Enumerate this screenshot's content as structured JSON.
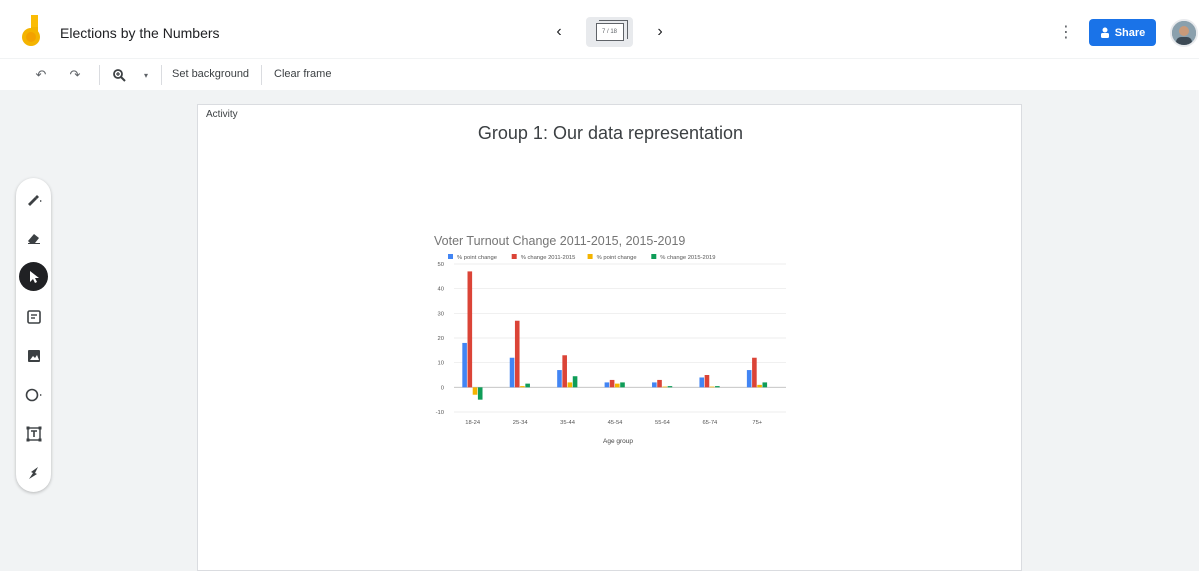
{
  "app": {
    "title": "Elections by the Numbers",
    "frame_counter": "7 / 18"
  },
  "header": {
    "share_label": "Share"
  },
  "toolbar": {
    "set_background": "Set background",
    "clear_frame": "Clear frame"
  },
  "canvas": {
    "activity_label": "Activity",
    "slide_title": "Group 1: Our data representation"
  },
  "colors": {
    "accent": "#1a73e8",
    "series_blue": "#4285f4",
    "series_red": "#db4437",
    "series_yellow": "#f4b400",
    "series_green": "#0f9d58"
  },
  "icons": [
    "undo-icon",
    "redo-icon",
    "zoom-icon",
    "pen-icon",
    "eraser-icon",
    "pointer-icon",
    "sticky-note-icon",
    "image-icon",
    "circle-icon",
    "text-box-icon",
    "laser-icon"
  ],
  "chart_data": {
    "type": "bar",
    "title": "Voter Turnout Change 2011-2015, 2015-2019",
    "xlabel": "Age group",
    "ylabel": "",
    "ylim": [
      -10,
      50
    ],
    "yticks": [
      -10,
      0,
      10,
      20,
      30,
      40,
      50
    ],
    "grid": true,
    "legend_position": "top",
    "categories": [
      "18-24",
      "25-34",
      "35-44",
      "45-54",
      "55-64",
      "65-74",
      "75+"
    ],
    "series": [
      {
        "name": "% point change",
        "color": "#4285f4",
        "values": [
          18,
          12,
          7,
          2,
          2,
          4,
          7
        ]
      },
      {
        "name": "% change 2011-2015",
        "color": "#db4437",
        "values": [
          47,
          27,
          13,
          3,
          3,
          5,
          12
        ]
      },
      {
        "name": "% point change",
        "color": "#f4b400",
        "values": [
          -3,
          0.5,
          2,
          1.5,
          0.3,
          0.3,
          1
        ]
      },
      {
        "name": "% change 2015-2019",
        "color": "#0f9d58",
        "values": [
          -5,
          1.5,
          4.5,
          2,
          0.5,
          0.5,
          2
        ]
      }
    ]
  }
}
